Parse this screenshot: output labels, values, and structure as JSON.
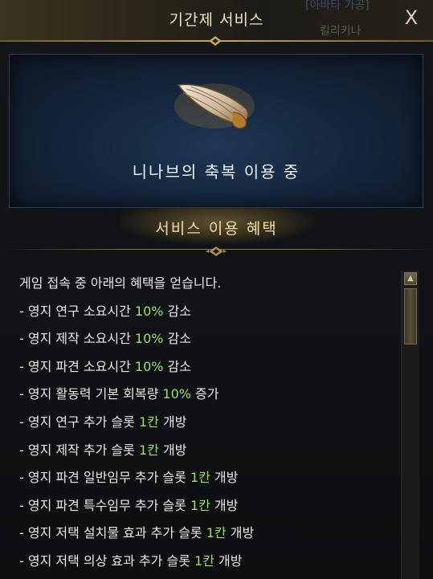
{
  "window": {
    "title": "기간제 서비스",
    "close_label": "X",
    "background_top_text": "[아바타 가공]",
    "background_bottom_text": "킬리키나"
  },
  "hero": {
    "icon": "wing-icon",
    "status_text": "니나브의 축복 이용 중"
  },
  "section": {
    "title": "서비스 이용 혜택"
  },
  "benefits": {
    "intro": "게임 접속 중 아래의 혜택을 얻습니다.",
    "items": [
      {
        "prefix": "- 영지 연구 소요시간 ",
        "value": "10%",
        "suffix": " 감소"
      },
      {
        "prefix": "- 영지 제작 소요시간 ",
        "value": "10%",
        "suffix": " 감소"
      },
      {
        "prefix": "- 영지 파견 소요시간 ",
        "value": "10%",
        "suffix": " 감소"
      },
      {
        "prefix": "- 영지 활동력 기본 회복량 ",
        "value": "10%",
        "suffix": " 증가"
      },
      {
        "prefix": "- 영지 연구 추가 슬롯 ",
        "value": "1칸",
        "suffix": " 개방"
      },
      {
        "prefix": "- 영지 제작 추가 슬롯 ",
        "value": "1칸",
        "suffix": " 개방"
      },
      {
        "prefix": "- 영지 파견 일반임무 추가 슬롯 ",
        "value": "1칸",
        "suffix": " 개방"
      },
      {
        "prefix": "- 영지 파견 특수임무 추가 슬롯 ",
        "value": "1칸",
        "suffix": " 개방"
      },
      {
        "prefix": "- 영지 저택 설치물 효과 추가 슬롯 ",
        "value": "1칸",
        "suffix": " 개방"
      },
      {
        "prefix": "- 영지 저택 의상 효과 추가 슬롯 ",
        "value": "1칸",
        "suffix": " 개방"
      }
    ]
  },
  "scrollbar": {
    "up_icon": "arrow-up-icon",
    "down_icon": "arrow-down-icon"
  },
  "colors": {
    "highlight": "#9ce06b",
    "title_text": "#e9e3cf",
    "section_title": "#f0dfa8",
    "body_text": "#e8e8e8"
  }
}
